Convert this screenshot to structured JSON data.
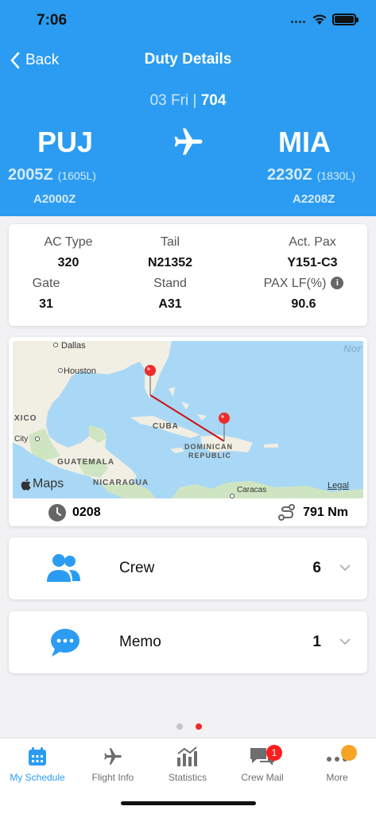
{
  "status": {
    "time": "7:06"
  },
  "nav": {
    "back_label": "Back",
    "title": "Duty Details"
  },
  "flight": {
    "date": "03 Fri",
    "separator": "|",
    "number": "704",
    "origin": {
      "code": "PUJ",
      "time_z": "2005Z",
      "time_l": "(1605L)",
      "alt_time": "A2000Z"
    },
    "destination": {
      "code": "MIA",
      "time_z": "2230Z",
      "time_l": "(1830L)",
      "alt_time": "A2208Z"
    }
  },
  "details": {
    "ac_type": {
      "label": "AC Type",
      "value": "320"
    },
    "tail": {
      "label": "Tail",
      "value": "N21352"
    },
    "act_pax": {
      "label": "Act. Pax",
      "value": "Y151-C3"
    },
    "gate": {
      "label": "Gate",
      "value": "31"
    },
    "stand": {
      "label": "Stand",
      "value": "A31"
    },
    "pax_lf": {
      "label": "PAX LF(%)",
      "value": "90.6",
      "info_icon": "i"
    }
  },
  "map": {
    "labels": {
      "dallas": "Dallas",
      "houston": "Houston",
      "xico": "XICO",
      "city": "City",
      "cuba": "CUBA",
      "dominican": "DOMINICAN",
      "republic": "REPUBLIC",
      "guatemala": "GUATEMALA",
      "nicaragua": "NICARAGUA",
      "caracas": "Caracas",
      "nor": "Nor",
      "brand": "Maps",
      "legal": "Legal"
    },
    "block_time": "0208",
    "distance": "791 Nm"
  },
  "crew": {
    "label": "Crew",
    "count": "6"
  },
  "memo": {
    "label": "Memo",
    "count": "1"
  },
  "tabs": [
    {
      "label": "My Schedule",
      "icon": "calendar-icon",
      "active": true
    },
    {
      "label": "Flight Info",
      "icon": "airplane-icon"
    },
    {
      "label": "Statistics",
      "icon": "chart-icon"
    },
    {
      "label": "Crew Mail",
      "icon": "chat-icon",
      "badge": "1"
    },
    {
      "label": "More",
      "icon": "more-icon"
    }
  ],
  "colors": {
    "brand": "#2b9cf2",
    "badge": "#ff1d1d",
    "route": "#cc1111",
    "pin": "#f02b2b",
    "more_badge": "#f7a325"
  }
}
